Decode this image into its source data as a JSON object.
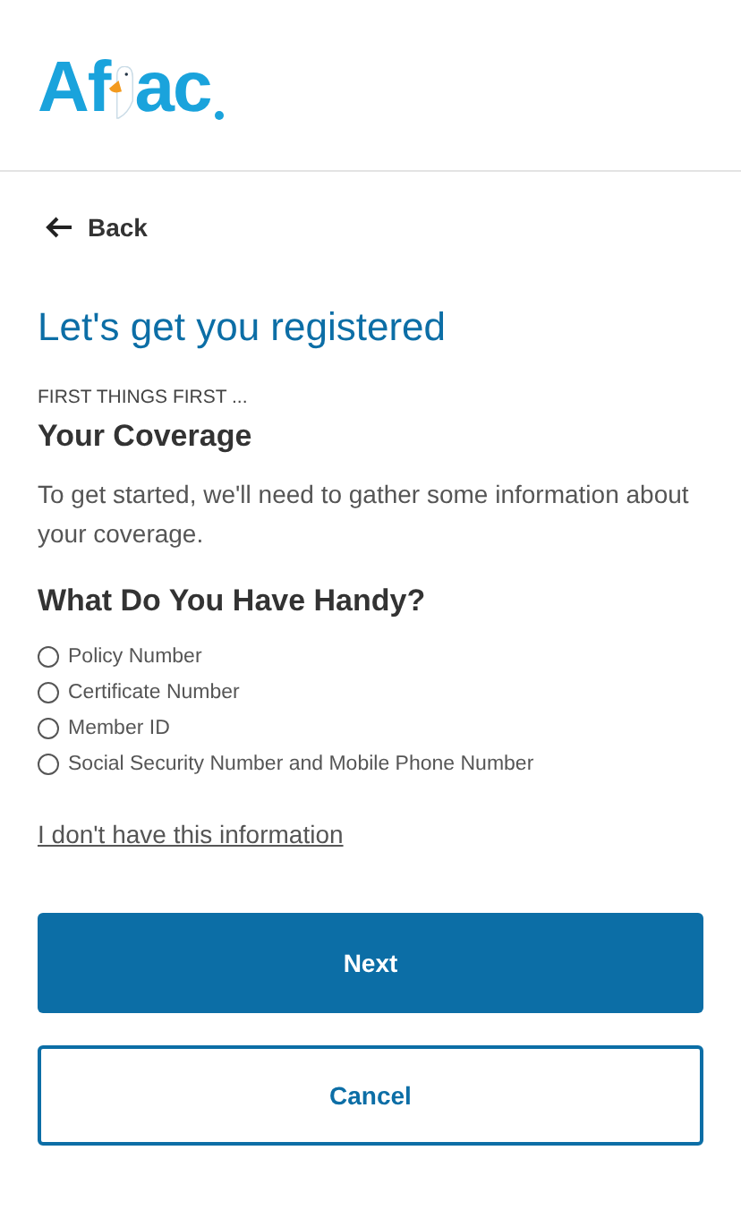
{
  "logo": {
    "before": "Af",
    "after": "ac"
  },
  "back": {
    "label": "Back"
  },
  "title": "Let's get you registered",
  "eyebrow": "FIRST THINGS FIRST ...",
  "section_title": "Your Coverage",
  "intro": "To get started, we'll need to gather some information about your coverage.",
  "question": "What Do You Have Handy?",
  "options": [
    {
      "label": "Policy Number",
      "selected": false
    },
    {
      "label": "Certificate Number",
      "selected": false
    },
    {
      "label": "Member ID",
      "selected": false
    },
    {
      "label": "Social Security Number and Mobile Phone Number",
      "selected": false
    }
  ],
  "help_link": "I don't have this information",
  "buttons": [
    {
      "label": "Next",
      "kind": "primary"
    },
    {
      "label": "Cancel",
      "kind": "secondary"
    }
  ]
}
